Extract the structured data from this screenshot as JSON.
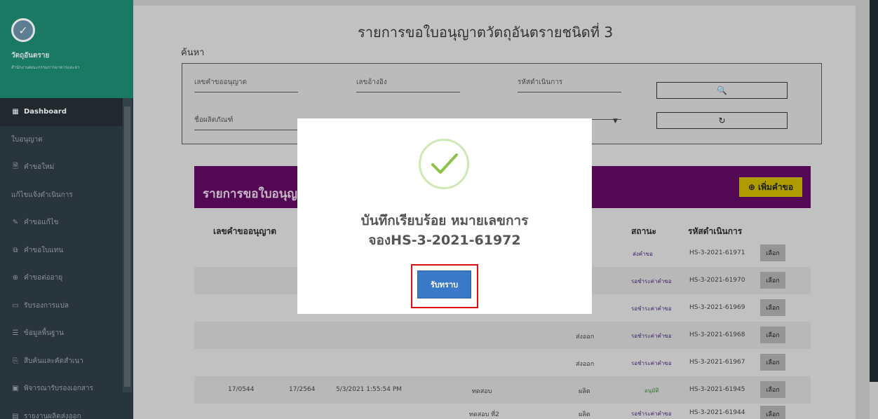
{
  "sidebar": {
    "brand_title": "วัตถุอันตราย",
    "brand_sub": "สำนักงานคณะกรรมการอาหารและยา",
    "items": [
      {
        "icon": "▦",
        "label": "Dashboard"
      },
      {
        "icon": "",
        "label": "ใบอนุญาต"
      },
      {
        "icon": "🗎",
        "label": "คำขอใหม่"
      },
      {
        "icon": "",
        "label": "แก้ไขแจ้งดำเนินการ"
      },
      {
        "icon": "✎",
        "label": "คำขอแก้ไข"
      },
      {
        "icon": "⧉",
        "label": "คำขอใบแทน"
      },
      {
        "icon": "⊕",
        "label": "คำขอต่ออายุ"
      },
      {
        "icon": "▭",
        "label": "รับรองการแปล"
      },
      {
        "icon": "☰",
        "label": "ข้อมูลพื้นฐาน"
      },
      {
        "icon": "⎘",
        "label": "สืบค้นและคัดสำเนา"
      },
      {
        "icon": "▣",
        "label": "พิจารณารับรองเอกสาร"
      },
      {
        "icon": "▤",
        "label": "รายงานผลิตส่งออก"
      }
    ]
  },
  "page": {
    "title": "รายการขอใบอนุญาตวัตถุอันตรายชนิดที่ 3",
    "search_label": "ค้นหา",
    "fields": {
      "req_no": "เลขคำขออนุญาต",
      "ref_no": "เลขอ้างอิง",
      "op_code": "รหัสดำเนินการ",
      "product": "ชื่อผลิตภัณฑ์"
    },
    "search_icon": "🔍",
    "reset_icon": "↻"
  },
  "panel": {
    "title": "รายการขอใบอนุญ",
    "add_button": "เพิ่มคำขอ",
    "headers": {
      "req_no": "เลขคำขออนุญาต",
      "status": "สถานะ",
      "op_code": "รหัสดำเนินการ"
    },
    "rows": [
      {
        "col1": "",
        "col2": "",
        "col3": "",
        "col4": "",
        "col5": "",
        "status": "ส่งคำขอ",
        "code": "HS-3-2021-61971",
        "select": "เลือก"
      },
      {
        "col1": "",
        "col2": "",
        "col3": "",
        "col4": "",
        "col5": "",
        "status": "รอชำระค่าคำขอ",
        "code": "HS-3-2021-61970",
        "select": "เลือก"
      },
      {
        "col1": "",
        "col2": "",
        "col3": "",
        "col4": "",
        "col5": "",
        "status": "รอชำระค่าคำขอ",
        "code": "HS-3-2021-61969",
        "select": "เลือก"
      },
      {
        "col1": "",
        "col2": "",
        "col3": "",
        "col4": "",
        "col5": "ส่งออก",
        "status": "รอชำระค่าคำขอ",
        "code": "HS-3-2021-61968",
        "select": "เลือก"
      },
      {
        "col1": "",
        "col2": "",
        "col3": "",
        "col4": "",
        "col5": "ส่งออก",
        "status": "รอชำระค่าคำขอ",
        "code": "HS-3-2021-61967",
        "select": "เลือก"
      },
      {
        "col1": "17/0544",
        "col2": "17/2564",
        "col3": "5/3/2021 1:55:54 PM",
        "col4": "ทดสอบ",
        "col5": "ผลิต",
        "status": "อนุมัติ",
        "code": "HS-3-2021-61945",
        "select": "เลือก"
      },
      {
        "col1": "",
        "col2": "",
        "col3": "",
        "col4": "ทดสอบ ที่2",
        "col5": "ผลิต",
        "status": "รอชำระค่าคำขอ",
        "code": "HS-3-2021-61944",
        "select": "เลือก"
      }
    ]
  },
  "modal": {
    "title_line1": "บันทึกเรียบร้อย หมายเลขการ",
    "title_line2": "จองHS-3-2021-61972",
    "ok_button": "รับทราบ"
  },
  "colors": {
    "brand": "#1d8a70",
    "panel_head": "#5e0a5e",
    "ok_button": "#3a78c8",
    "highlight": "#e01010"
  }
}
